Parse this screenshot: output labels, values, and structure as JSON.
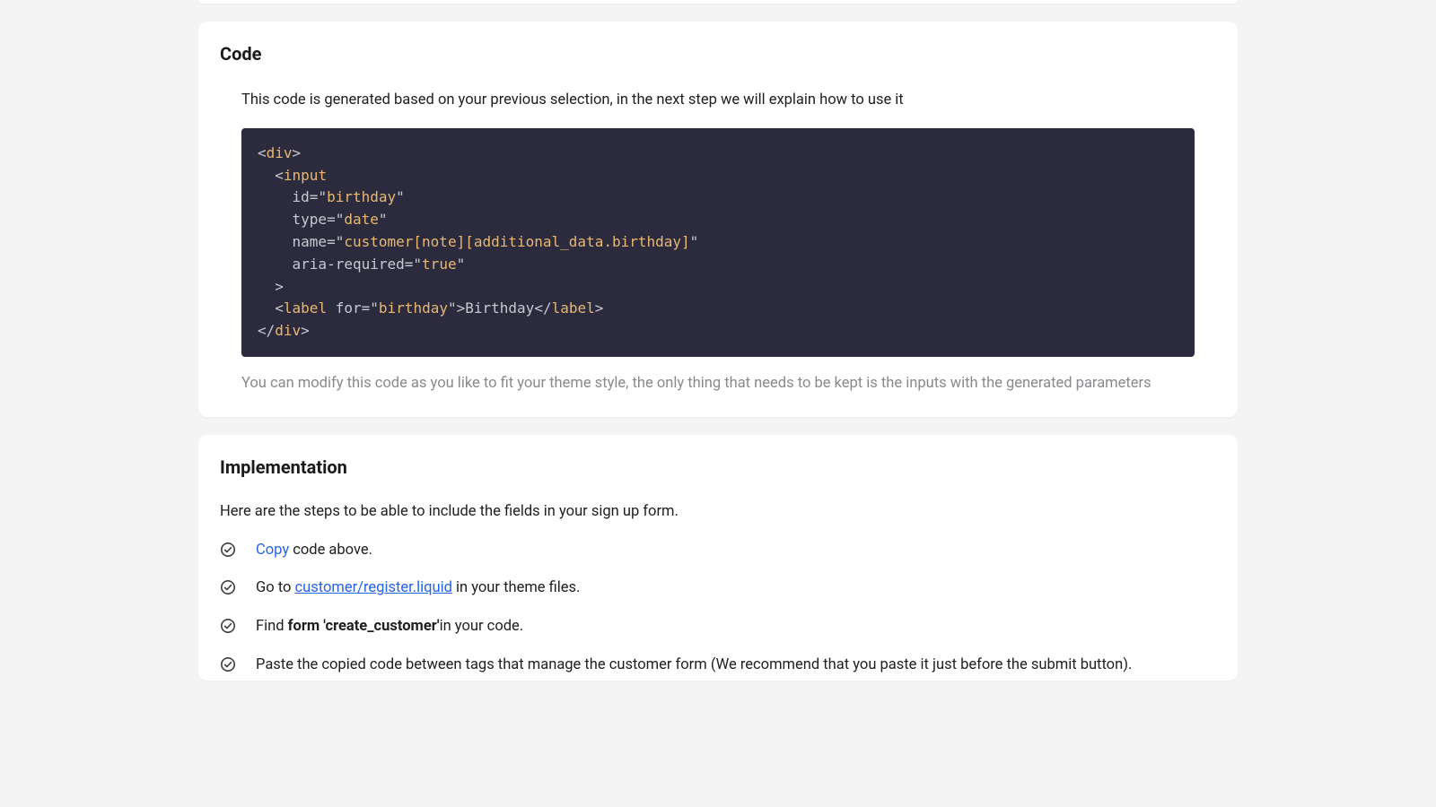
{
  "code_section": {
    "heading": "Code",
    "description": "This code is generated based on your previous selection, in the next step we will explain how to use it",
    "note": "You can modify this code as you like to fit your theme style, the only thing that needs to be kept is the inputs with the generated parameters",
    "snippet": {
      "lines": [
        {
          "indent": 0,
          "tokens": [
            {
              "t": "punct",
              "v": "<"
            },
            {
              "t": "tag",
              "v": "div"
            },
            {
              "t": "punct",
              "v": ">"
            }
          ]
        },
        {
          "indent": 1,
          "tokens": [
            {
              "t": "punct",
              "v": "<"
            },
            {
              "t": "tag",
              "v": "input"
            }
          ]
        },
        {
          "indent": 2,
          "tokens": [
            {
              "t": "attr",
              "v": "id"
            },
            {
              "t": "eq",
              "v": "="
            },
            {
              "t": "punct",
              "v": "\""
            },
            {
              "t": "str",
              "v": "birthday"
            },
            {
              "t": "punct",
              "v": "\""
            }
          ]
        },
        {
          "indent": 2,
          "tokens": [
            {
              "t": "attr",
              "v": "type"
            },
            {
              "t": "eq",
              "v": "="
            },
            {
              "t": "punct",
              "v": "\""
            },
            {
              "t": "str",
              "v": "date"
            },
            {
              "t": "punct",
              "v": "\""
            }
          ]
        },
        {
          "indent": 2,
          "tokens": [
            {
              "t": "attr",
              "v": "name"
            },
            {
              "t": "eq",
              "v": "="
            },
            {
              "t": "punct",
              "v": "\""
            },
            {
              "t": "str",
              "v": "customer[note][additional_data.birthday]"
            },
            {
              "t": "punct",
              "v": "\""
            }
          ]
        },
        {
          "indent": 2,
          "tokens": [
            {
              "t": "attr",
              "v": "aria-required"
            },
            {
              "t": "eq",
              "v": "="
            },
            {
              "t": "punct",
              "v": "\""
            },
            {
              "t": "str",
              "v": "true"
            },
            {
              "t": "punct",
              "v": "\""
            }
          ]
        },
        {
          "indent": 1,
          "tokens": [
            {
              "t": "punct",
              "v": ">"
            }
          ]
        },
        {
          "indent": 1,
          "tokens": [
            {
              "t": "punct",
              "v": "<"
            },
            {
              "t": "tag",
              "v": "label"
            },
            {
              "t": "text",
              "v": " "
            },
            {
              "t": "attr",
              "v": "for"
            },
            {
              "t": "eq",
              "v": "="
            },
            {
              "t": "punct",
              "v": "\""
            },
            {
              "t": "str",
              "v": "birthday"
            },
            {
              "t": "punct",
              "v": "\""
            },
            {
              "t": "punct",
              "v": ">"
            },
            {
              "t": "text",
              "v": "Birthday"
            },
            {
              "t": "punct",
              "v": "</"
            },
            {
              "t": "tag",
              "v": "label"
            },
            {
              "t": "punct",
              "v": ">"
            }
          ]
        },
        {
          "indent": 0,
          "tokens": [
            {
              "t": "punct",
              "v": "</"
            },
            {
              "t": "tag",
              "v": "div"
            },
            {
              "t": "punct",
              "v": ">"
            }
          ]
        }
      ]
    }
  },
  "impl_section": {
    "heading": "Implementation",
    "lead": "Here are the steps to be able to include the fields in your sign up form.",
    "steps": [
      {
        "parts": [
          {
            "type": "link",
            "text": "Copy"
          },
          {
            "type": "text",
            "text": " code above."
          }
        ]
      },
      {
        "parts": [
          {
            "type": "text",
            "text": "Go to "
          },
          {
            "type": "link_underline",
            "text": "customer/register.liquid"
          },
          {
            "type": "text",
            "text": " in your theme files."
          }
        ]
      },
      {
        "parts": [
          {
            "type": "text",
            "text": "Find "
          },
          {
            "type": "bold",
            "text": "form 'create_customer'"
          },
          {
            "type": "text",
            "text": "in your code."
          }
        ]
      },
      {
        "parts": [
          {
            "type": "text",
            "text": "Paste the copied code between tags that manage the customer form (We recommend that you paste it just before the submit button)."
          }
        ]
      }
    ]
  }
}
